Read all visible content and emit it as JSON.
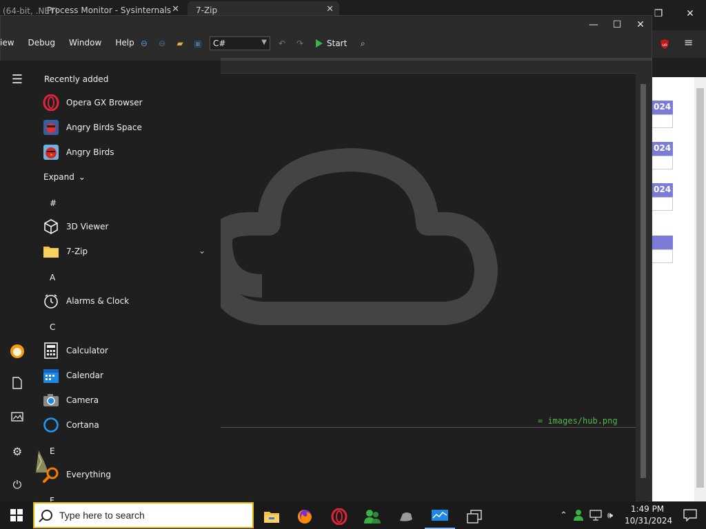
{
  "browser": {
    "tab1_title": "Process Monitor - Sysinternals",
    "tab2_title": "7-Zip",
    "page_pill_text": "024"
  },
  "ide": {
    "title": "(64-bit, .NET)",
    "menu": [
      "iew",
      "Debug",
      "Window",
      "Help"
    ],
    "language": "C#",
    "start_label": "Start",
    "editor_link": "= images/hub.png"
  },
  "start_menu": {
    "recently_added_label": "Recently added",
    "recent_items": [
      {
        "label": "Opera GX Browser",
        "icon": "opera-gx-icon"
      },
      {
        "label": "Angry Birds Space",
        "icon": "angry-birds-space-icon"
      },
      {
        "label": "Angry Birds",
        "icon": "angry-birds-icon"
      }
    ],
    "expand_label": "Expand",
    "groups": [
      {
        "letter": "#",
        "items": [
          {
            "label": "3D Viewer",
            "icon": "cube-icon"
          },
          {
            "label": "7-Zip",
            "icon": "folder-icon"
          }
        ]
      },
      {
        "letter": "A",
        "items": [
          {
            "label": "Alarms & Clock",
            "icon": "alarm-clock-icon"
          }
        ]
      },
      {
        "letter": "C",
        "items": [
          {
            "label": "Calculator",
            "icon": "calculator-icon"
          },
          {
            "label": "Calendar",
            "icon": "calendar-icon"
          },
          {
            "label": "Camera",
            "icon": "camera-icon"
          },
          {
            "label": "Cortana",
            "icon": "cortana-icon"
          }
        ]
      },
      {
        "letter": "E",
        "items": [
          {
            "label": "Everything",
            "icon": "everything-search-icon"
          }
        ]
      },
      {
        "letter": "F",
        "items": []
      }
    ]
  },
  "taskbar": {
    "search_placeholder": "Type here to search",
    "time": "1:49 PM",
    "date": "10/31/2024"
  },
  "colors": {
    "accent": "#8ab4f8",
    "search_border": "#e6b800",
    "start_green": "#3bb44a"
  }
}
